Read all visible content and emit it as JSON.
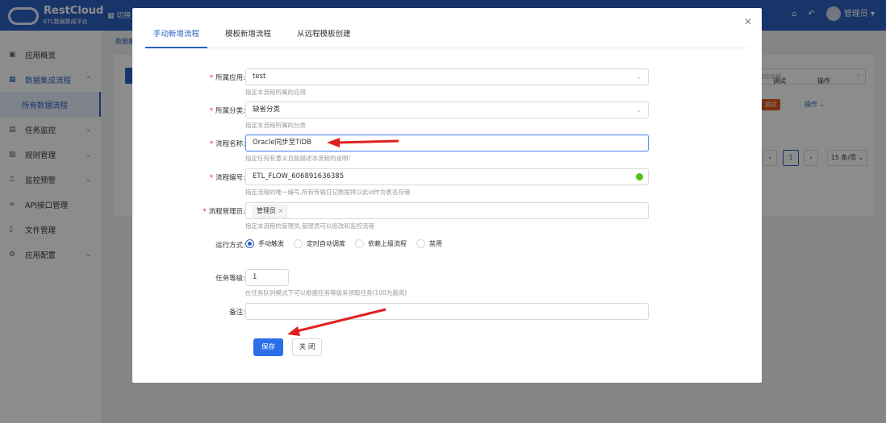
{
  "header": {
    "logo_title": "RestCloud",
    "logo_subtitle": "ETL数据集成平台",
    "switch_label": "切换",
    "user": "管理员"
  },
  "sidebar": {
    "items": [
      {
        "label": "应用概览",
        "icon": "overview-icon"
      },
      {
        "label": "数据集成流程",
        "icon": "grid-icon",
        "expanded": true
      },
      {
        "label": "所有数据流程",
        "sub": true
      },
      {
        "label": "任务监控",
        "icon": "monitor-icon"
      },
      {
        "label": "规则管理",
        "icon": "rule-icon"
      },
      {
        "label": "监控预警",
        "icon": "alarm-icon"
      },
      {
        "label": "API接口管理",
        "icon": "link-icon"
      },
      {
        "label": "文件管理",
        "icon": "file-icon"
      },
      {
        "label": "应用配置",
        "icon": "gear-icon"
      }
    ]
  },
  "main": {
    "breadcrumb": "数据集",
    "search_placeholder": "流程名称",
    "columns": [
      "调试",
      "操作"
    ],
    "debug_tag": "调试",
    "op_link": "操作",
    "page": "1",
    "page_size": "15 条/页"
  },
  "modal": {
    "tabs": [
      "手动新增流程",
      "模板新增流程",
      "从远程模板创建"
    ],
    "fields": {
      "app": {
        "label": "所属应用:",
        "value": "test",
        "hint": "指定本流程所属的应用"
      },
      "category": {
        "label": "所属分类:",
        "value": "缺省分类",
        "hint": "指定本流程所属的分类"
      },
      "name": {
        "label": "流程名称:",
        "value": "Oracle同步至TiDB",
        "hint": "指定任何有意义且能描述本流程的说明!"
      },
      "id": {
        "label": "流程编号:",
        "value": "ETL_FLOW_606891636385",
        "hint": "指定流程的唯一编号,所有传输日记数据将以此id作为表名存储"
      },
      "managers": {
        "label": "流程管理员:",
        "chip": "管理员",
        "hint": "指定本流程的管理员,管理员可以修改和监控流程"
      },
      "run_mode": {
        "label": "运行方式:",
        "options": [
          "手动触发",
          "定时自动调度",
          "依赖上级流程",
          "禁用"
        ],
        "selected": "手动触发"
      },
      "level": {
        "label": "任务等级:",
        "value": "1",
        "hint": "在任务队列模式下可以根据任务等级来领取任务(100为最高)"
      },
      "remark": {
        "label": "备注:",
        "value": ""
      }
    },
    "save": "保存",
    "close": "关 闭"
  },
  "colors": {
    "primary": "#2c62c0",
    "required": "#f5222d",
    "annotation_arrow": "#e02020"
  }
}
